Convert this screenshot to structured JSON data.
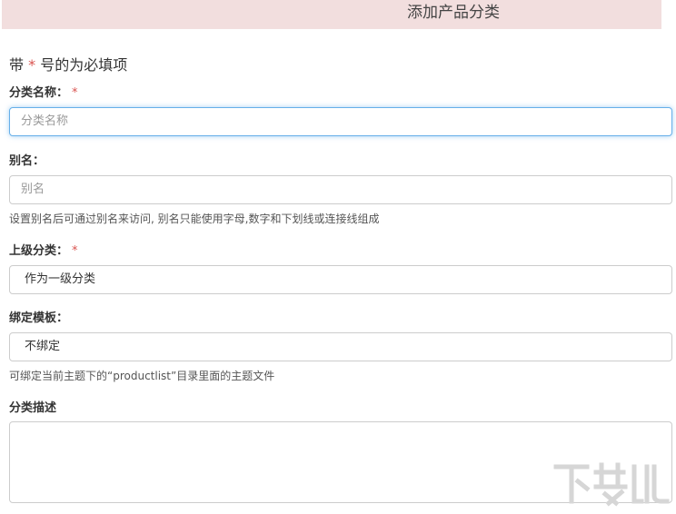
{
  "header": {
    "title": "添加产品分类"
  },
  "form": {
    "required_note_prefix": "带",
    "required_star": "*",
    "required_note_suffix": "号的为必填项",
    "name": {
      "label": "分类名称：",
      "required": "*",
      "placeholder": "分类名称"
    },
    "alias": {
      "label": "别名：",
      "placeholder": "别名",
      "help": "设置别名后可通过别名来访问, 别名只能使用字母,数字和下划线或连接线组成"
    },
    "parent": {
      "label": "上级分类：",
      "required": "*",
      "value": "作为一级分类"
    },
    "template": {
      "label": "绑定模板：",
      "value": "不绑定",
      "help": "可绑定当前主题下的“productlist”目录里面的主题文件"
    },
    "description": {
      "label": "分类描述",
      "value": ""
    }
  },
  "colors": {
    "header_bg": "#f2dede",
    "required_star": "#d9534f",
    "focus_border": "#66afe9"
  }
}
